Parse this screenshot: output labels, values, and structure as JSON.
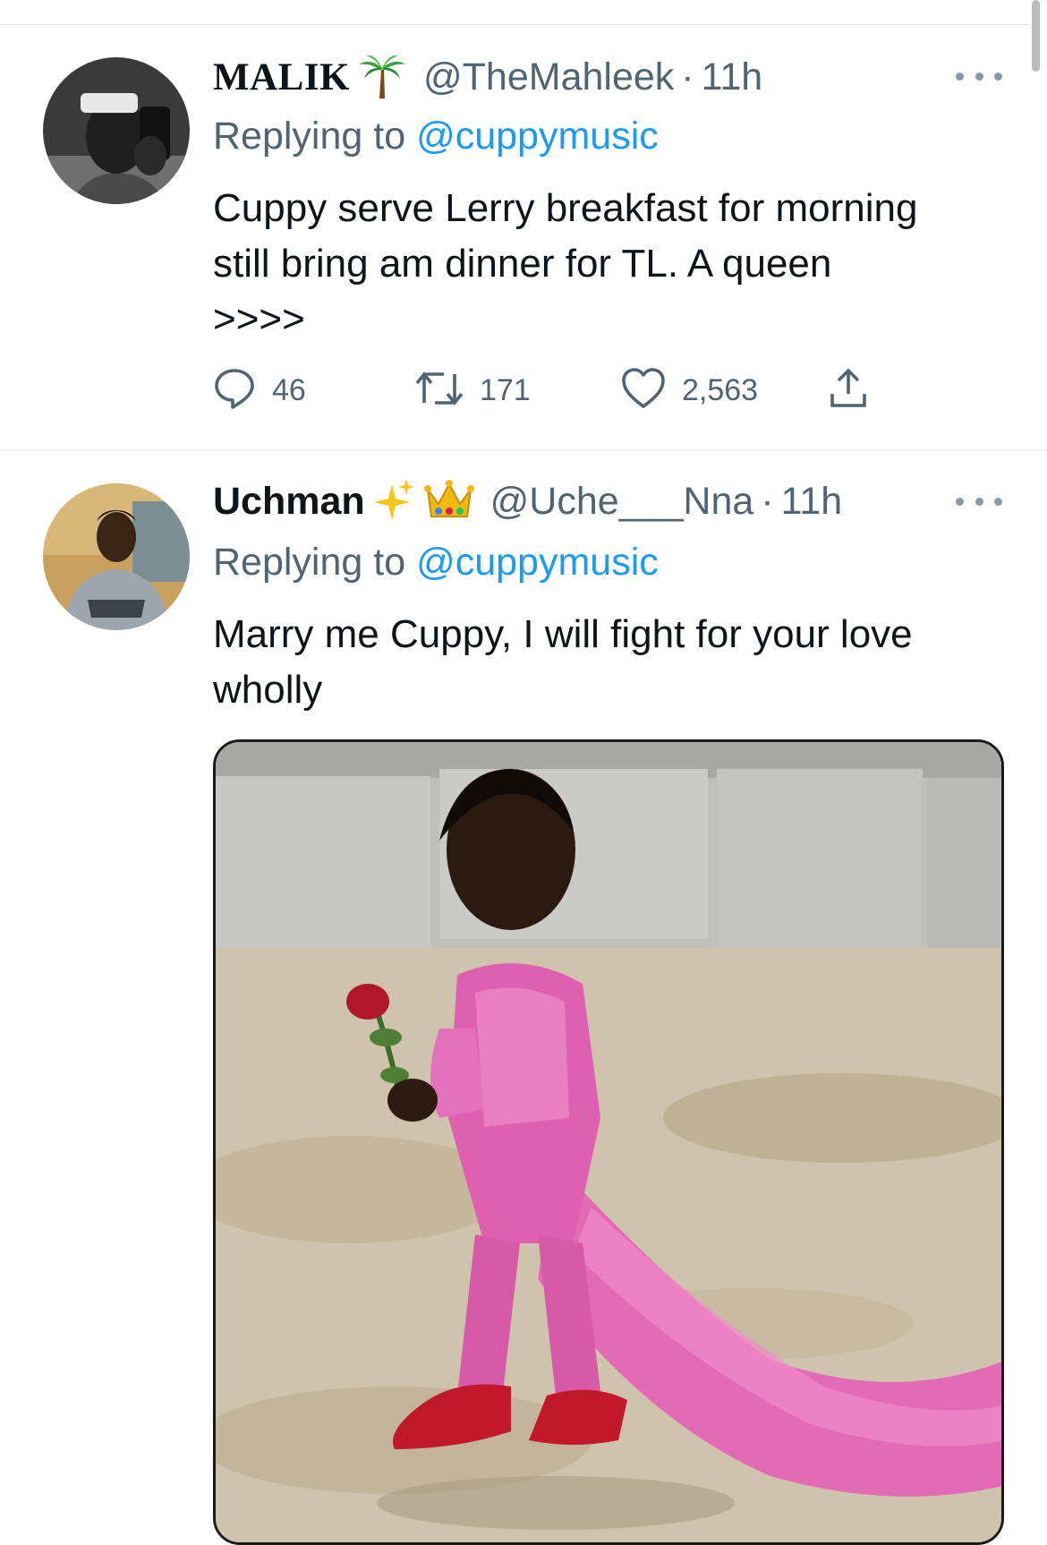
{
  "tweets": [
    {
      "name": "MALIK",
      "name_emoji": "palm-tree",
      "handle": "@TheMahleek",
      "separator": "·",
      "time": "11h",
      "replying_prefix": "Replying to ",
      "replying_to": "@cuppymusic",
      "text_lines": [
        "Cuppy serve Lerry breakfast for morning",
        "still bring am dinner for TL. A queen",
        ">>>>"
      ],
      "replies": "46",
      "retweets": "171",
      "likes": "2,563"
    },
    {
      "name": "Uchman",
      "name_emoji": "sparkles, crown",
      "handle": "@Uche___Nna",
      "separator": "·",
      "time": "11h",
      "replying_prefix": "Replying to ",
      "replying_to": "@cuppymusic",
      "text_lines": [
        "Marry me Cuppy, I will fight for your love",
        "wholly"
      ]
    }
  ],
  "colors": {
    "text": "#0f1419",
    "secondary": "#536471",
    "link": "#1d9bf0",
    "divider": "#eff3f4"
  },
  "icons": [
    "more-icon",
    "reply-icon",
    "retweet-icon",
    "like-icon",
    "share-icon"
  ]
}
